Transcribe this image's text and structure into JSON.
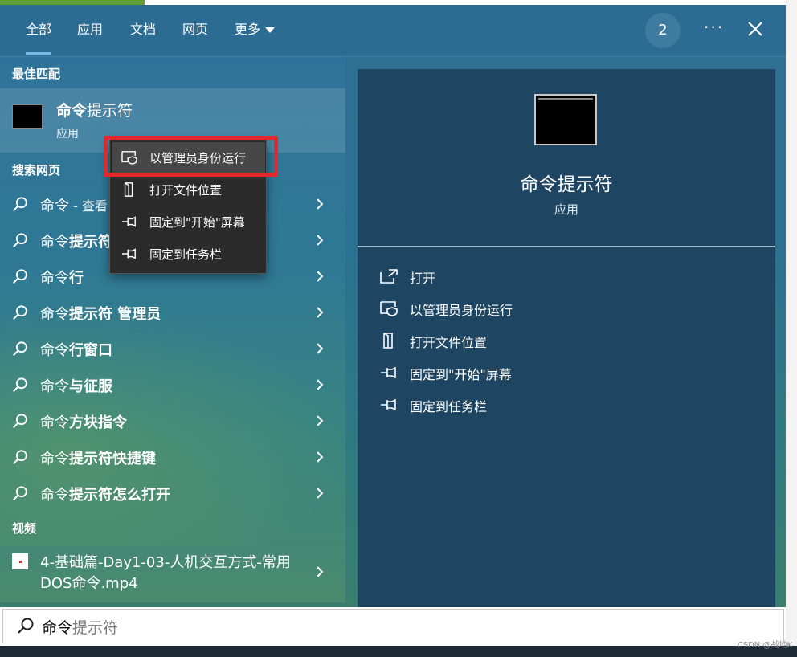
{
  "tabs": [
    {
      "label": "全部",
      "active": true
    },
    {
      "label": "应用"
    },
    {
      "label": "文档"
    },
    {
      "label": "网页"
    },
    {
      "label": "更多"
    }
  ],
  "header": {
    "badge": "2",
    "more_glyph": "···"
  },
  "sections": {
    "best_match": "最佳匹配",
    "search_web": "搜索网页",
    "videos": "视频"
  },
  "best_match": {
    "name_bold": "命令",
    "name_rest": "提示符",
    "type": "应用"
  },
  "web_results": [
    {
      "query": "命令",
      "rest": "",
      "extra": " - 查看"
    },
    {
      "query": "命令",
      "rest": "提示符",
      "extra": ""
    },
    {
      "query": "命令",
      "rest": "行",
      "extra": ""
    },
    {
      "query": "命令",
      "rest": "提示符 管理员",
      "extra": ""
    },
    {
      "query": "命令",
      "rest": "行窗口",
      "extra": ""
    },
    {
      "query": "命令",
      "rest": "与征服",
      "extra": ""
    },
    {
      "query": "命令",
      "rest": "方块指令",
      "extra": ""
    },
    {
      "query": "命令",
      "rest": "提示符快捷键",
      "extra": ""
    },
    {
      "query": "命令",
      "rest": "提示符怎么打开",
      "extra": ""
    }
  ],
  "video": {
    "title": "4-基础篇-Day1-03-人机交互方式-常用DOS命令.mp4"
  },
  "context_menu": [
    {
      "label": "以管理员身份运行",
      "icon": "shield-window-icon"
    },
    {
      "label": "打开文件位置",
      "icon": "folder-door-icon"
    },
    {
      "label": "固定到\"开始\"屏幕",
      "icon": "pin-icon"
    },
    {
      "label": "固定到任务栏",
      "icon": "pin-icon"
    }
  ],
  "preview": {
    "title": "命令提示符",
    "subtitle": "应用",
    "actions": [
      {
        "label": "打开",
        "icon": "open-icon"
      },
      {
        "label": "以管理员身份运行",
        "icon": "shield-window-icon"
      },
      {
        "label": "打开文件位置",
        "icon": "folder-door-icon"
      },
      {
        "label": "固定到\"开始\"屏幕",
        "icon": "pin-icon"
      },
      {
        "label": "固定到任务栏",
        "icon": "pin-icon"
      }
    ]
  },
  "search": {
    "typed": "命令",
    "suggestion": "提示符"
  },
  "watermark": "CSDN @战地K",
  "colors": {
    "highlight_frame": "#e5262a",
    "header": "#2c6c93",
    "preview_bg": "#1e4561"
  }
}
